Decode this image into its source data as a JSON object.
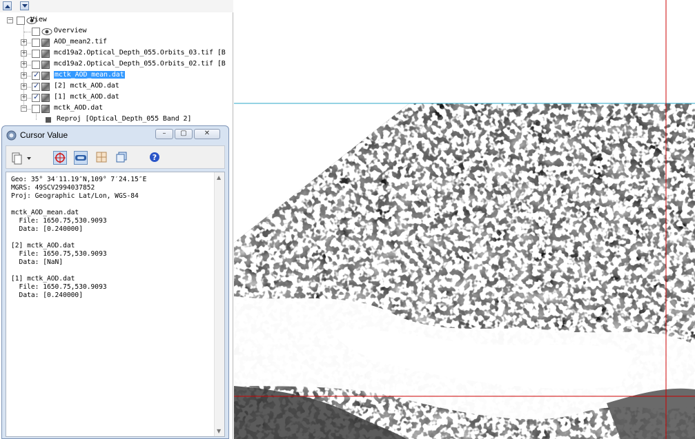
{
  "layer_tree": {
    "items": [
      {
        "label": "View",
        "checked": false,
        "expander": "minus",
        "icon": "eye-icon"
      },
      {
        "label": "Overview",
        "checked": false,
        "expander": "",
        "icon": "eye-icon"
      },
      {
        "label": "AOD_mean2.tif",
        "checked": false,
        "expander": "plus",
        "icon": "raster-layer-icon"
      },
      {
        "label": "mcd19a2.Optical_Depth_055.Orbits_03.tif [B",
        "checked": false,
        "expander": "plus",
        "icon": "raster-layer-icon"
      },
      {
        "label": "mcd19a2.Optical_Depth_055.Orbits_02.tif [B",
        "checked": false,
        "expander": "plus",
        "icon": "raster-layer-icon"
      },
      {
        "label": "mctk_AOD_mean.dat",
        "checked": true,
        "expander": "plus",
        "icon": "raster-layer-icon",
        "selected": true
      },
      {
        "label": "[2] mctk_AOD.dat",
        "checked": true,
        "expander": "plus",
        "icon": "raster-layer-icon"
      },
      {
        "label": "[1] mctk_AOD.dat",
        "checked": true,
        "expander": "plus",
        "icon": "raster-layer-icon"
      },
      {
        "label": "mctk_AOD.dat",
        "checked": false,
        "expander": "minus",
        "icon": "raster-layer-icon"
      },
      {
        "label": "Reproj [Optical_Depth_055 Band 2]",
        "checked": false,
        "expander": "",
        "icon": "band-icon"
      }
    ]
  },
  "cursor_dialog": {
    "title": "Cursor Value",
    "window_buttons": {
      "minimize": "–",
      "restore": "▢",
      "close": "✕"
    },
    "toolbar_icons": [
      "copy-dropdown-icon",
      "crosshair-icon",
      "link-icon",
      "grid-icon",
      "windows-icon",
      "help-icon"
    ],
    "lines": [
      "Geo: 35° 34′11.19″N,109° 7′24.15″E",
      "MGRS: 49SCV2994037852",
      "Proj: Geographic Lat/Lon, WGS-84",
      "",
      "mctk_AOD_mean.dat",
      "  File: 1650.75,530.9093",
      "  Data: [0.240000]",
      "",
      "[2] mctk_AOD.dat",
      "  File: 1650.75,530.9093",
      "  Data: [NaN]",
      "",
      "[1] mctk_AOD.dat",
      "  File: 1650.75,530.9093",
      "  Data: [0.240000]"
    ]
  },
  "image_view": {
    "crosshair_color": "#cc0000",
    "boundary_color": "#2aa7c7"
  }
}
